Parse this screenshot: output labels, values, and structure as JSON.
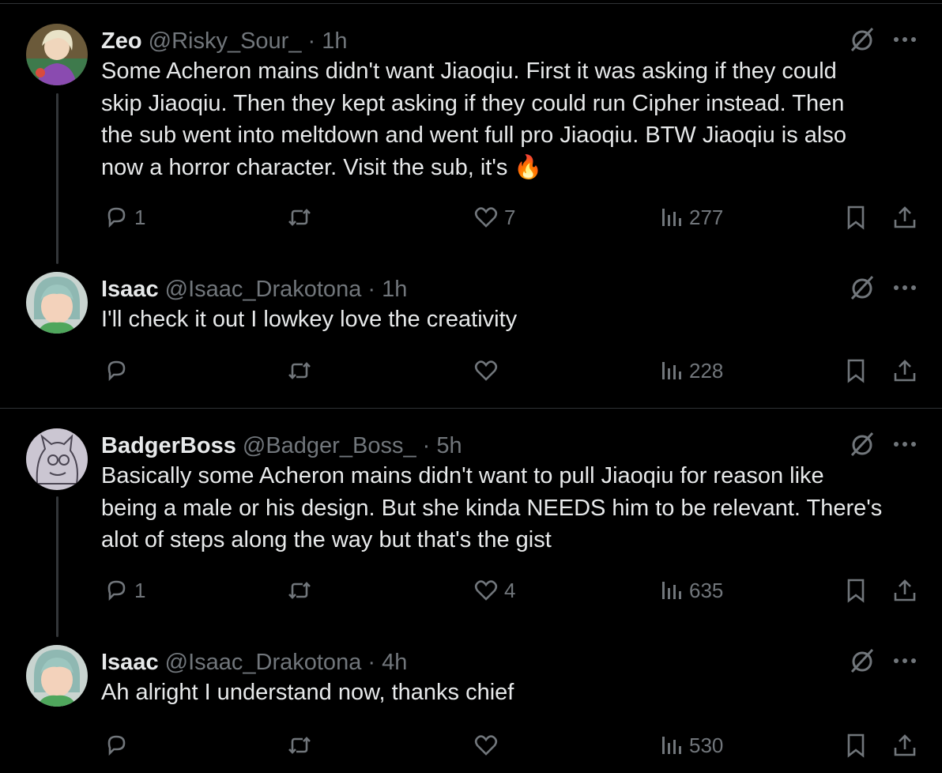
{
  "tweets": [
    {
      "name": "Zeo",
      "handle": "@Risky_Sour_",
      "dot": "·",
      "time": "1h",
      "text": "Some Acheron mains didn't want Jiaoqiu. First it was asking if they could\nskip Jiaoqiu. Then they kept asking if they could run Cipher instead. Then\nthe sub went into meltdown and went full pro Jiaoqiu. BTW Jiaoqiu is also\nnow a horror character. Visit the sub, it's",
      "emoji": "🔥",
      "replies": "1",
      "retweets": "",
      "likes": "7",
      "views": "277"
    },
    {
      "name": "Isaac",
      "handle": "@Isaac_Drakotona",
      "dot": "·",
      "time": "1h",
      "text": "I'll check it out I lowkey love the creativity",
      "emoji": "",
      "replies": "",
      "retweets": "",
      "likes": "",
      "views": "228"
    },
    {
      "name": "BadgerBoss",
      "handle": "@Badger_Boss_",
      "dot": "·",
      "time": "5h",
      "text": "Basically some Acheron mains didn't want to pull Jiaoqiu for reason like\nbeing a male or his design. But she kinda NEEDS him to be relevant. There's\nalot of steps along the way but that's the gist",
      "emoji": "",
      "replies": "1",
      "retweets": "",
      "likes": "4",
      "views": "635"
    },
    {
      "name": "Isaac",
      "handle": "@Isaac_Drakotona",
      "dot": "·",
      "time": "4h",
      "text": "Ah alright I understand now, thanks chief",
      "emoji": "",
      "replies": "",
      "retweets": "",
      "likes": "",
      "views": "530"
    }
  ],
  "icons": {
    "reply": "reply-icon",
    "retweet": "retweet-icon",
    "like": "like-icon",
    "views": "views-icon",
    "bookmark": "bookmark-icon",
    "share": "share-icon",
    "grok": "grok-icon",
    "more": "more-icon"
  },
  "colors": {
    "background": "#000000",
    "text": "#e7e9ea",
    "muted": "#71767b",
    "border": "#2f3336"
  }
}
